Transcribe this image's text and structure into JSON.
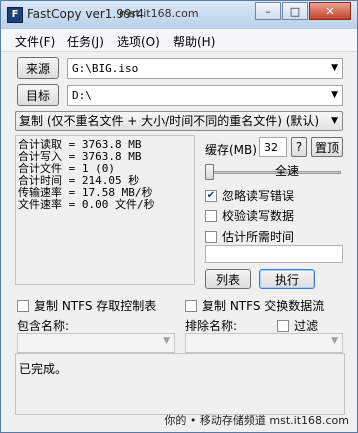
{
  "window": {
    "app_icon_text": "F",
    "title": "FastCopy ver1.99r4",
    "watermark": "mst.it168.com",
    "controls": {
      "minimize": "–",
      "maximize": "□",
      "close": "✕"
    }
  },
  "menu": [
    {
      "label": "文件(F)"
    },
    {
      "label": "任务(J)"
    },
    {
      "label": "选项(O)"
    },
    {
      "label": "帮助(H)"
    }
  ],
  "source": {
    "button": "来源",
    "value": "G:\\BIG.iso"
  },
  "destination": {
    "button": "目标",
    "value": "D:\\"
  },
  "mode": {
    "selected": "复制 (仅不重名文件 + 大小/时间不同的重名文件) (默认)"
  },
  "stats": {
    "lines": [
      "合计读取 = 3763.8 MB",
      "合计写入 = 3763.8 MB",
      "合计文件 = 1 (0)",
      "合计时间 = 214.05 秒",
      "传输速率 = 17.58 MB/秒",
      "文件速率 = 0.00 文件/秒"
    ]
  },
  "options": {
    "buffer_label": "缓存(MB)",
    "buffer_value": "32",
    "help_button": "?",
    "top_button": "置顶",
    "speed_label": "全速",
    "speed_level_pct": 100,
    "ignore_errors": {
      "label": "忽略读写错误",
      "checked": true
    },
    "verify": {
      "label": "校验读写数据",
      "checked": false
    },
    "estimate": {
      "label": "估计所需时间",
      "checked": false
    },
    "list_button": "列表",
    "execute_button": "执行"
  },
  "ntfs": {
    "acl": {
      "label": "复制 NTFS 存取控制表",
      "checked": false
    },
    "streams": {
      "label": "复制 NTFS 交换数据流",
      "checked": false
    }
  },
  "filters": {
    "include_label": "包含名称:",
    "exclude_label": "排除名称:",
    "filter_toggle": {
      "label": "过滤",
      "checked": false
    }
  },
  "log": {
    "text": "已完成。"
  },
  "footer": {
    "watermark": "你的 • 移动存储频道  mst.it168.com"
  }
}
